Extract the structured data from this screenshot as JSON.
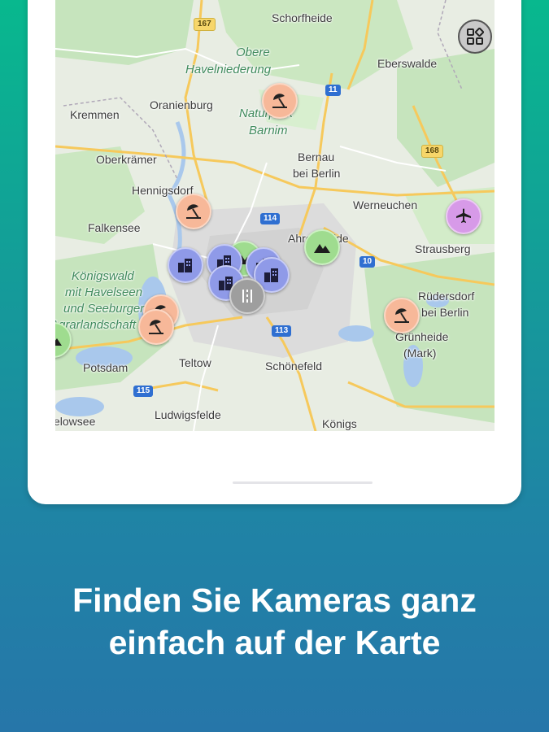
{
  "map": {
    "places": [
      {
        "id": "schorfheide",
        "label": "Schorfheide"
      },
      {
        "id": "obere",
        "label": "Obere"
      },
      {
        "id": "havelniederung",
        "label": "Havelniederung"
      },
      {
        "id": "eberswalde",
        "label": "Eberswalde"
      },
      {
        "id": "kremmen",
        "label": "Kremmen"
      },
      {
        "id": "oranienburg",
        "label": "Oranienburg"
      },
      {
        "id": "naturpark",
        "label": "Naturpark"
      },
      {
        "id": "barnim",
        "label": "Barnim"
      },
      {
        "id": "oberkraemer",
        "label": "Oberkrämer"
      },
      {
        "id": "bernau",
        "label": "Bernau"
      },
      {
        "id": "bei-berlin",
        "label": "bei Berlin"
      },
      {
        "id": "hennigsdorf",
        "label": "Hennigsdorf"
      },
      {
        "id": "werneuchen",
        "label": "Werneuchen"
      },
      {
        "id": "falkensee",
        "label": "Falkensee"
      },
      {
        "id": "ahrensfelde",
        "label": "Ahrensfelde"
      },
      {
        "id": "strausberg",
        "label": "Strausberg"
      },
      {
        "id": "koenigswald",
        "label": "Königswald"
      },
      {
        "id": "mit-havelseen",
        "label": "mit Havelseen"
      },
      {
        "id": "und-seeburger",
        "label": "und Seeburger"
      },
      {
        "id": "agrarlandschaft",
        "label": "Agrarlandschaft"
      },
      {
        "id": "ruedersdorf",
        "label": "Rüdersdorf"
      },
      {
        "id": "bei-berlin-2",
        "label": "bei Berlin"
      },
      {
        "id": "gruenheide",
        "label": "Grünheide"
      },
      {
        "id": "mark",
        "label": "(Mark)"
      },
      {
        "id": "potsdam",
        "label": "Potsdam"
      },
      {
        "id": "teltow",
        "label": "Teltow"
      },
      {
        "id": "schoenefeld",
        "label": "Schönefeld"
      },
      {
        "id": "ludwigsfelde",
        "label": "Ludwigsfelde"
      },
      {
        "id": "werder",
        "label": "elowsee"
      },
      {
        "id": "koenigs",
        "label": "Königs"
      }
    ],
    "road_shields": [
      "167",
      "11",
      "168",
      "114",
      "10",
      "113",
      "115"
    ],
    "markers": [
      {
        "type": "beach",
        "icon": "umbrella-icon"
      },
      {
        "type": "beach",
        "icon": "umbrella-icon"
      },
      {
        "type": "beach",
        "icon": "umbrella-icon"
      },
      {
        "type": "beach",
        "icon": "umbrella-icon"
      },
      {
        "type": "beach",
        "icon": "umbrella-icon"
      },
      {
        "type": "city",
        "icon": "buildings-icon"
      },
      {
        "type": "city",
        "icon": "buildings-icon"
      },
      {
        "type": "city",
        "icon": "buildings-icon"
      },
      {
        "type": "city",
        "icon": "buildings-icon"
      },
      {
        "type": "mountain",
        "icon": "mountain-icon"
      },
      {
        "type": "mountain",
        "icon": "mountain-icon"
      },
      {
        "type": "airport",
        "icon": "airplane-icon"
      },
      {
        "type": "cluster",
        "icon": "cluster-icon"
      }
    ],
    "layers_button_icon": "grid-icon",
    "colors": {
      "beach": "#f7b899",
      "city": "#8f9ae8",
      "mountain": "#9fdc8f",
      "airport": "#d79ae8",
      "cluster": "#9e9e9e"
    }
  },
  "caption": {
    "line1": "Finden Sie Kameras ganz",
    "line2": "einfach auf der Karte"
  },
  "colors": {
    "background_top": "#08b88e",
    "background_bottom": "#2676a9",
    "caption_text": "#ffffff"
  }
}
